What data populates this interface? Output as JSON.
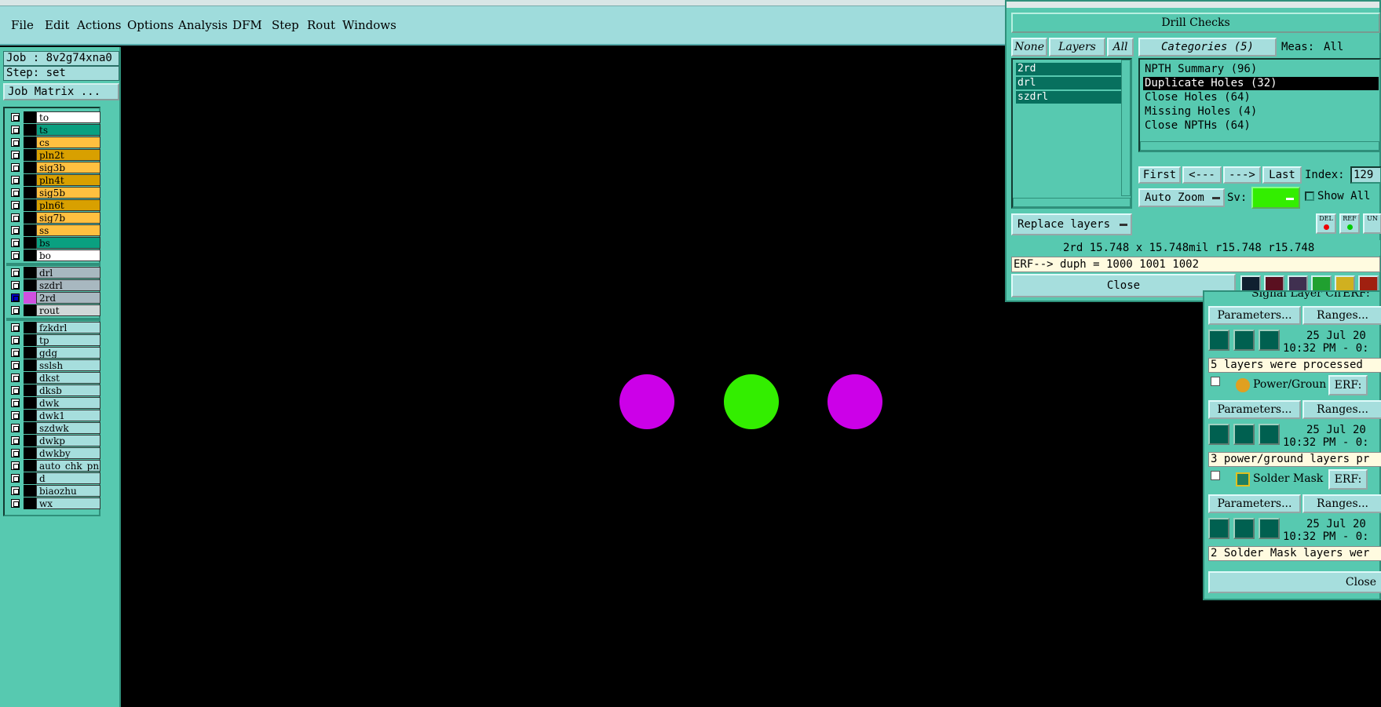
{
  "menubar": {
    "items": [
      "File",
      "Edit",
      "Actions",
      "Options",
      "Analysis",
      "DFM",
      "Step",
      "Rout",
      "Windows"
    ]
  },
  "left_panel": {
    "job": "Job : 8v2g74xna0",
    "step": "Step: set",
    "job_matrix": "Job Matrix ...",
    "layers": [
      {
        "name": "to",
        "color": "#ffffff"
      },
      {
        "name": "ts",
        "color": "#0aa080"
      },
      {
        "name": "cs",
        "color": "#ffc040"
      },
      {
        "name": "pln2t",
        "color": "#d8a000"
      },
      {
        "name": "sig3b",
        "color": "#ffc040"
      },
      {
        "name": "pln4t",
        "color": "#d8a000"
      },
      {
        "name": "sig5b",
        "color": "#ffc040"
      },
      {
        "name": "pln6t",
        "color": "#d8a000"
      },
      {
        "name": "sig7b",
        "color": "#ffc040"
      },
      {
        "name": "ss",
        "color": "#ffc040"
      },
      {
        "name": "bs",
        "color": "#0aa080"
      },
      {
        "name": "bo",
        "color": "#ffffff"
      }
    ],
    "drill_layers": [
      {
        "name": "drl",
        "color": "#a8b8c0"
      },
      {
        "name": "szdrl",
        "color": "#a8b8c0"
      },
      {
        "name": "2rd",
        "color": "#a8b8c0"
      },
      {
        "name": "rout",
        "color": "#d0d8d8"
      }
    ],
    "other_layers": [
      "fzkdrl",
      "tp",
      "gdg",
      "sslsh",
      "dkst",
      "dksb",
      "dwk",
      "dwk1",
      "szdwk",
      "dwkp",
      "dwkby",
      "auto_chk_pn",
      "d",
      "biaozhu",
      "wx"
    ]
  },
  "canvas": {
    "pads": [
      {
        "color": "#cc00e8"
      },
      {
        "color": "#33ee00"
      },
      {
        "color": "#cc00e8"
      }
    ]
  },
  "results_viewer": {
    "header": "Drill Checks",
    "none_btn": "None",
    "layers_btn": "Layers",
    "all_btn": "All",
    "categories_btn": "Categories (5)",
    "meas_label": "Meas:",
    "meas_value": "All",
    "layers": [
      "2rd",
      "drl",
      "szdrl"
    ],
    "categories": [
      "NPTH Summary (96)",
      "Duplicate Holes (32)",
      "Close Holes (64)",
      "Missing Holes (4)",
      "Close NPTHs (64)"
    ],
    "nav": {
      "first": "First",
      "prev": "<---",
      "next": "--->",
      "last": "Last",
      "index_label": "Index:",
      "index_value": "129"
    },
    "auto_zoom": "Auto Zoom",
    "sv_label": "Sv:",
    "show_all": "Show All",
    "replace_layers": "Replace layers",
    "small_btns": [
      "DEL",
      "REF",
      "UN"
    ],
    "status_line": "2rd 15.748 x 15.748mil  r15.748  r15.748",
    "erf_line": "ERF--> duph = 1000 1001 1002",
    "close": "Close"
  },
  "checks_panel": {
    "top_name": "Signal Layer Ch",
    "top_erf": "ERF:",
    "params": "Parameters...",
    "ranges": "Ranges...",
    "date1": "25 Jul 20",
    "time1": "10:32 PM - 0:",
    "msg1": "5 layers were processed",
    "check2": "Power/Ground C",
    "erf": "ERF:",
    "date2": "25 Jul 20",
    "time2": "10:32 PM - 0:",
    "msg2": "3 power/ground layers pr",
    "check3": "Solder Mask Ch",
    "date3": "25 Jul 20",
    "time3": "10:32 PM - 0:",
    "msg3": "2 Solder Mask layers wer",
    "close": "Close"
  }
}
